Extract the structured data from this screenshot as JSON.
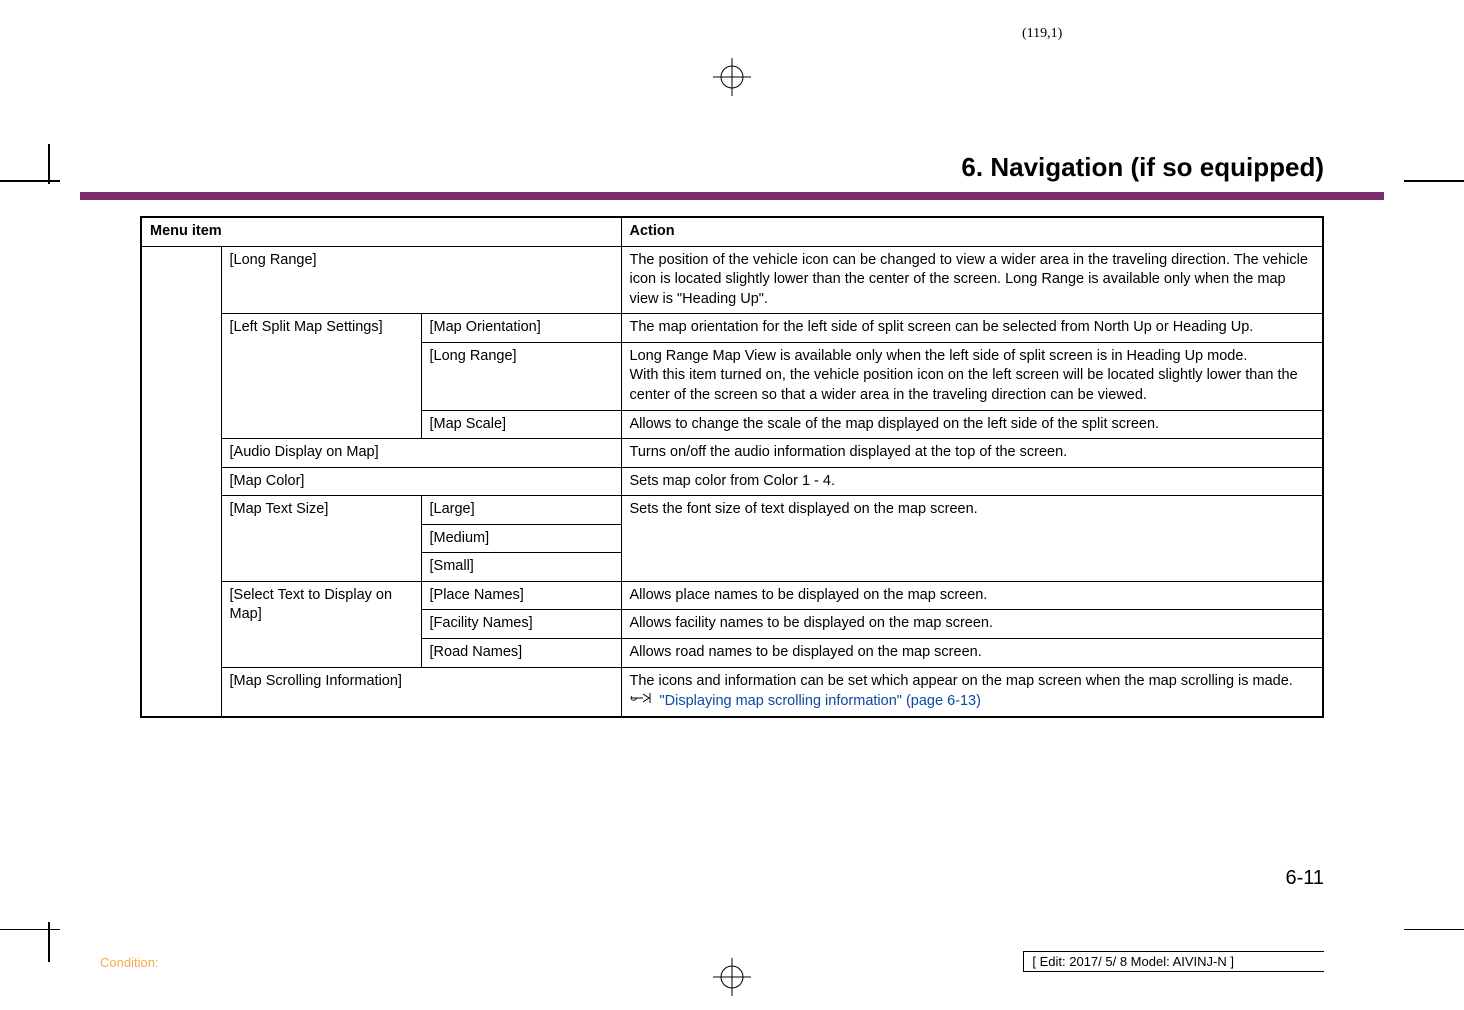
{
  "page_number_top": "(119,1)",
  "section_title": "6. Navigation (if so equipped)",
  "table": {
    "header": {
      "menu_item": "Menu item",
      "action": "Action"
    },
    "rows": {
      "long_range": {
        "label": "[Long Range]",
        "action": "The position of the vehicle icon can be changed to view a wider area in the traveling direction. The vehicle icon is located slightly lower than the center of the screen. Long Range is available only when the map view is \"Heading Up\"."
      },
      "left_split": {
        "label": "[Left Split Map Settings]",
        "map_orientation": {
          "label": "[Map Orientation]",
          "action": "The map orientation for the left side of split screen can be selected from North Up or Heading Up."
        },
        "long_range": {
          "label": "[Long Range]",
          "action": "Long Range Map View is available only when the left side of split screen is in Heading Up mode.\nWith this item turned on, the vehicle position icon on the left screen will be located slightly lower than the center of the screen so that a wider area in the traveling direction can be viewed."
        },
        "map_scale": {
          "label": "[Map Scale]",
          "action": "Allows to change the scale of the map displayed on the left side of the split screen."
        }
      },
      "audio_display": {
        "label": "[Audio Display on Map]",
        "action": "Turns on/off the audio information displayed at the top of the screen."
      },
      "map_color": {
        "label": "[Map Color]",
        "action": "Sets map color from Color 1 - 4."
      },
      "map_text_size": {
        "label": "[Map Text Size]",
        "large": "[Large]",
        "medium": "[Medium]",
        "small": "[Small]",
        "action": "Sets the font size of text displayed on the map screen."
      },
      "select_text": {
        "label": "[Select Text to Display on Map]",
        "place_names": {
          "label": "[Place Names]",
          "action": "Allows place names to be displayed on the map screen."
        },
        "facility_names": {
          "label": "[Facility Names]",
          "action": "Allows facility names to be displayed on the map screen."
        },
        "road_names": {
          "label": "[Road Names]",
          "action": "Allows road names to be displayed on the map screen."
        }
      },
      "map_scrolling": {
        "label": "[Map Scrolling Information]",
        "action_line1": "The icons and information can be set which appear on the map screen when the map scrolling is made.",
        "ref": "\"Displaying map scrolling information\" (page 6-13)"
      }
    }
  },
  "page_num_bottom": "6-11",
  "condition_label": "Condition:",
  "edit_info": "[ Edit: 2017/ 5/ 8    Model:  AIVINJ-N ]"
}
